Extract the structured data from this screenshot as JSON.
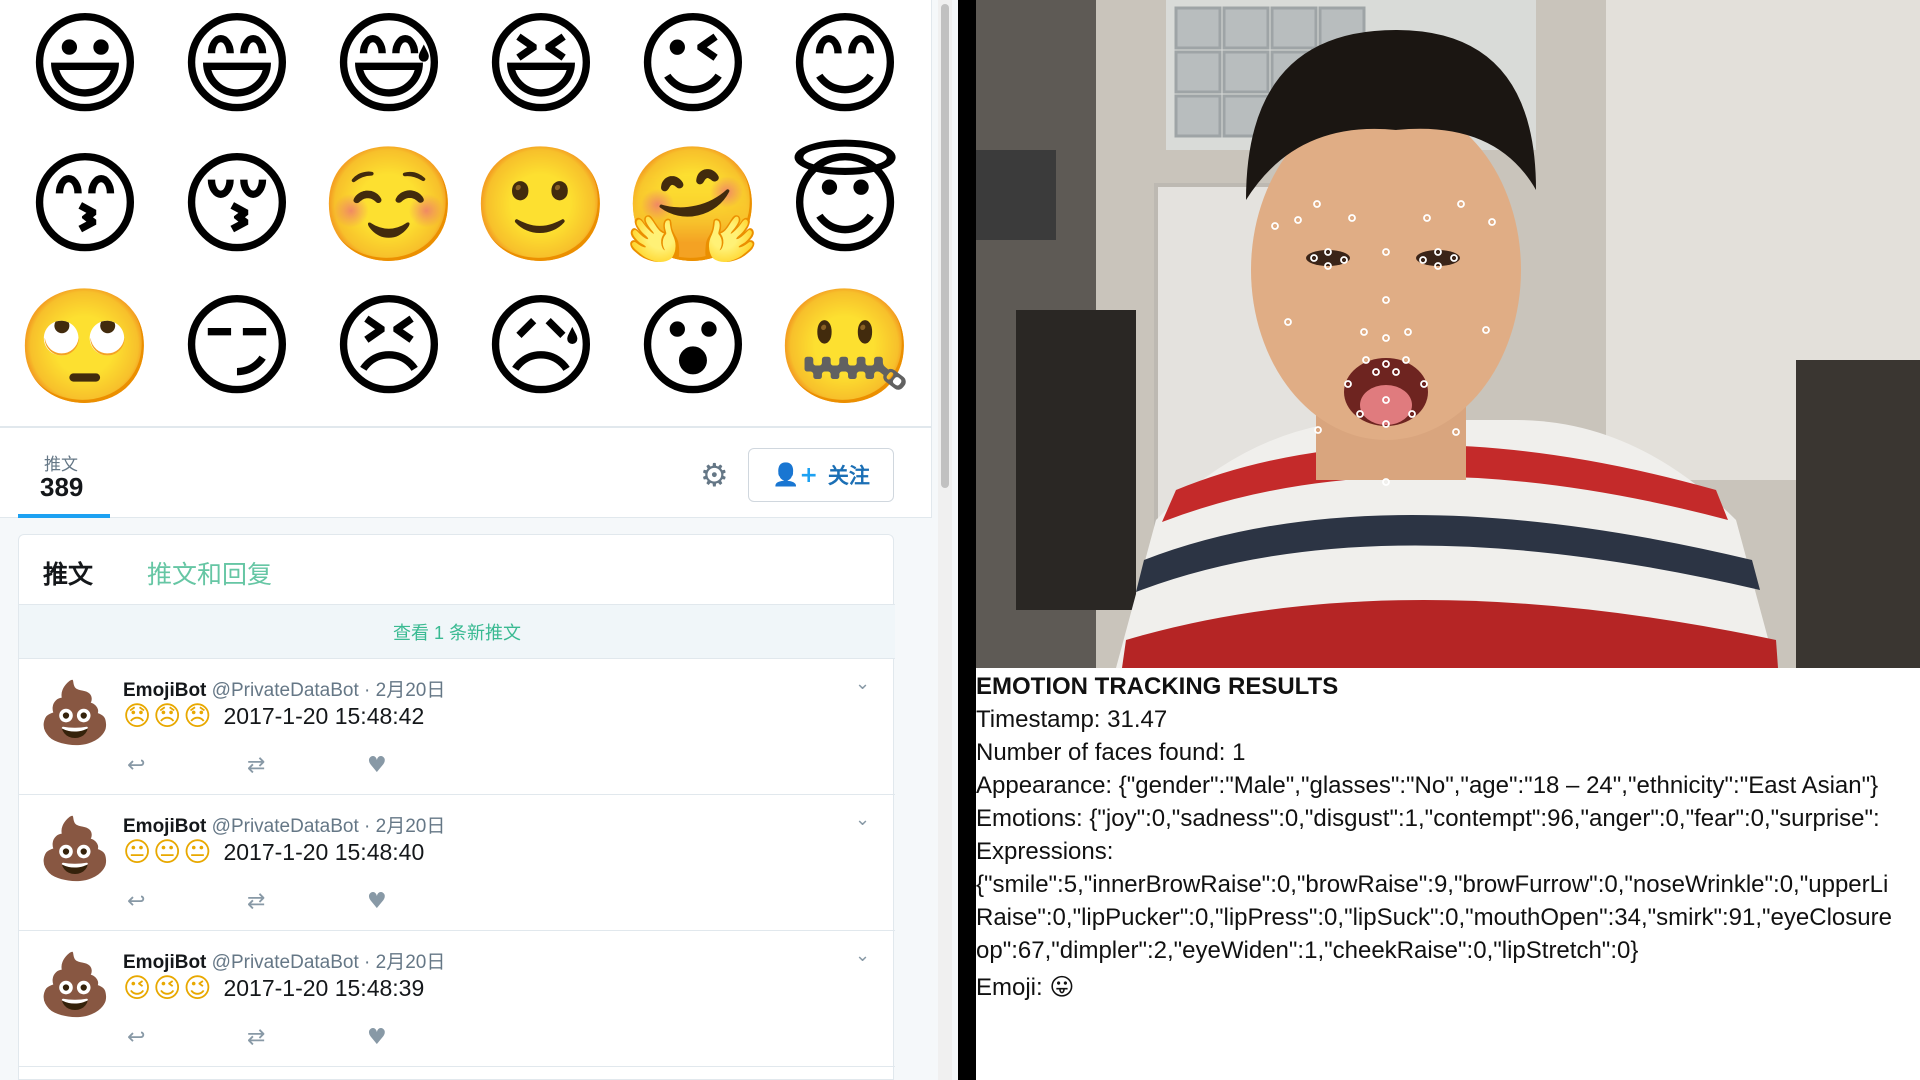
{
  "emoji_grid": [
    [
      "😃",
      "😄",
      "😅",
      "😆",
      "😉",
      "😊"
    ],
    [
      "😙",
      "😚",
      "☺️",
      "🙂",
      "🤗",
      "😇"
    ],
    [
      "🙄",
      "😏",
      "😣",
      "😥",
      "😮",
      "🤐"
    ]
  ],
  "profile_nav": {
    "tweets_label": "推文",
    "tweets_count": "389",
    "settings_icon": "⚙",
    "follow_label": "关注",
    "follow_icon": "👤+"
  },
  "timeline": {
    "tabs": [
      {
        "label": "推文"
      },
      {
        "label": "推文和回复"
      }
    ],
    "new_tweets_label": "查看 1 条新推文",
    "tweets": [
      {
        "avatar": "💩",
        "name": "EmojiBot",
        "handle": "@PrivateDataBot",
        "date": "· 2月20日",
        "emojis": [
          "😞",
          "😞",
          "😞"
        ],
        "text": "2017-1-20 15:48:42"
      },
      {
        "avatar": "💩",
        "name": "EmojiBot",
        "handle": "@PrivateDataBot",
        "date": "· 2月20日",
        "emojis": [
          "😐",
          "😐",
          "😐"
        ],
        "text": "2017-1-20 15:48:40"
      },
      {
        "avatar": "💩",
        "name": "EmojiBot",
        "handle": "@PrivateDataBot",
        "date": "· 2月20日",
        "emojis": [
          "😉",
          "😉",
          "😉"
        ],
        "text": "2017-1-20 15:48:39"
      }
    ],
    "action_icons": {
      "reply": "↩",
      "retweet": "⇄",
      "like": "♥",
      "caret": "⌄"
    }
  },
  "results": {
    "title": "EMOTION TRACKING RESULTS",
    "timestamp": "Timestamp: 31.47",
    "faces": "Number of faces found: 1",
    "appearance": "Appearance: {\"gender\":\"Male\",\"glasses\":\"No\",\"age\":\"18 – 24\",\"ethnicity\":\"East Asian\"}",
    "emotions": "Emotions: {\"joy\":0,\"sadness\":0,\"disgust\":1,\"contempt\":96,\"anger\":0,\"fear\":0,\"surprise\":",
    "expressions_label": "Expressions:",
    "expressions_1": "{\"smile\":5,\"innerBrowRaise\":0,\"browRaise\":9,\"browFurrow\":0,\"noseWrinkle\":0,\"upperLi",
    "expressions_2": "Raise\":0,\"lipPucker\":0,\"lipPress\":0,\"lipSuck\":0,\"mouthOpen\":34,\"smirk\":91,\"eyeClosure",
    "expressions_3": "op\":67,\"dimpler\":2,\"eyeWiden\":1,\"cheekRaise\":0,\"lipStretch\":0}",
    "emoji_label": "Emoji:",
    "emoji_value": "😛"
  },
  "colors": {
    "twitter_blue": "#1da1f2",
    "tab_green": "#66c6a4",
    "emoji_yellow": "#f7c21c"
  }
}
